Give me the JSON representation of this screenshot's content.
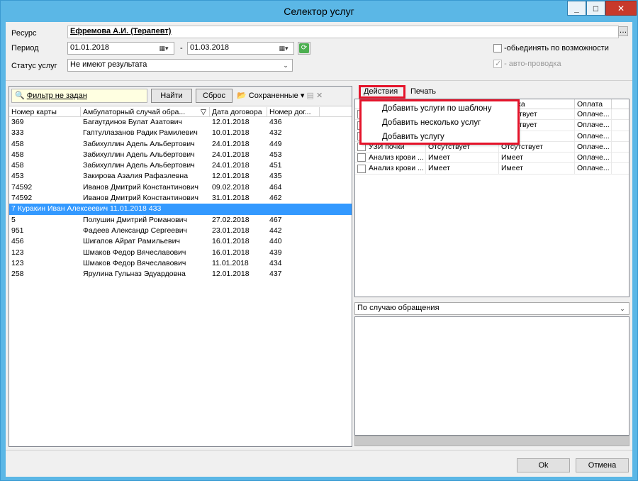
{
  "window": {
    "title": "Селектор услуг"
  },
  "form": {
    "resource_label": "Ресурс",
    "resource_value": "Ефремова А.И. (Терапевт)",
    "period_label": "Период",
    "period_from": "01.01.2018",
    "period_sep": "-",
    "period_to": "01.03.2018",
    "status_label": "Статус услуг",
    "status_value": "Не имеют результата",
    "combine_label": "-обьединять по возможности",
    "autopost_label": "- авто-проводка"
  },
  "left": {
    "filter_text": "Фильтр не задан",
    "find_label": "Найти",
    "reset_label": "Сброс",
    "saved_label": "Сохраненные",
    "columns": [
      "Номер карты",
      "Амбулаторный случай обра...",
      "Дата договора",
      "Номер дог..."
    ],
    "rows": [
      [
        "369",
        "Багаутдинов Булат Азатович",
        "12.01.2018",
        "436"
      ],
      [
        "333",
        "Гаптуллазанов Радик Рамилевич",
        "10.01.2018",
        "432"
      ],
      [
        "458",
        "Забихуллин Адель Альбертович",
        "24.01.2018",
        "449"
      ],
      [
        "458",
        "Забихуллин Адель Альбертович",
        "24.01.2018",
        "453"
      ],
      [
        "458",
        "Забихуллин Адель Альбертович",
        "24.01.2018",
        "451"
      ],
      [
        "453",
        "Закирова Азалия Рафаэлевна",
        "12.01.2018",
        "435"
      ],
      [
        "74592",
        "Иванов Дмитрий Константинович",
        "09.02.2018",
        "464"
      ],
      [
        "74592",
        "Иванов Дмитрий Константинович",
        "31.01.2018",
        "462"
      ],
      [
        "7",
        "Куракин Иван Алексеевич",
        "11.01.2018",
        "433"
      ],
      [
        "5",
        "Полушин Дмитрий Романович",
        "27.02.2018",
        "467"
      ],
      [
        "951",
        "Фадеев Александр Сергеевич",
        "23.01.2018",
        "442"
      ],
      [
        "456",
        "Шигапов Айрат Рамильевич",
        "16.01.2018",
        "440"
      ],
      [
        "123",
        "Шмаков Федор Вячеславович",
        "16.01.2018",
        "439"
      ],
      [
        "123",
        "Шмаков Федор Вячеславович",
        "11.01.2018",
        "434"
      ],
      [
        "258",
        "Ярулина Гульназ Эдуардовна",
        "12.01.2018",
        "437"
      ]
    ]
  },
  "right": {
    "tab_actions": "Действия",
    "tab_print": "Печать",
    "columns": [
      "",
      "",
      "оводка",
      "Оплата"
    ],
    "rows": [
      [
        "",
        "",
        "тсутствует",
        "Оплаче..."
      ],
      [
        "",
        "",
        "тсутствует",
        "Оплаче..."
      ],
      [
        "",
        "",
        "еет",
        "Оплаче..."
      ],
      [
        "УЗИ почки",
        "Отсутствует",
        "Отсутствует",
        "Оплаче..."
      ],
      [
        "Анализ крови ...",
        "Имеет",
        "Имеет",
        "Оплаче..."
      ],
      [
        "Анализ крови ...",
        "Имеет",
        "Имеет",
        "Оплаче..."
      ]
    ],
    "menu": [
      "Добавить услуги по шаблону",
      "Добавить несколько услуг",
      "Добавить услугу"
    ],
    "group_combo": "По случаю обращения"
  },
  "footer": {
    "ok_label": "Ok",
    "cancel_label": "Отмена"
  },
  "colors": {
    "selection": "#3399ff",
    "highlight": "#e5132a",
    "titlebar": "#5bb7e6",
    "filter_bg": "#ffffe1"
  }
}
